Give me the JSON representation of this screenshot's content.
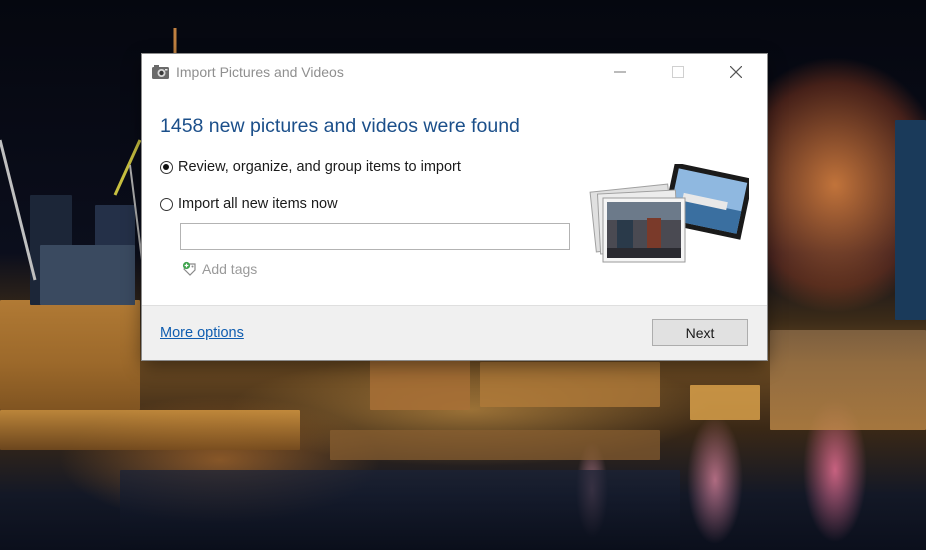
{
  "window": {
    "title": "Import Pictures and Videos",
    "heading": "1458 new pictures and videos were found"
  },
  "options": {
    "review": {
      "label": "Review, organize, and group items to import",
      "checked": true
    },
    "import_all": {
      "label": "Import all new items now",
      "checked": false
    }
  },
  "tags": {
    "input_value": "",
    "add_tags_label": "Add tags"
  },
  "footer": {
    "more_options_label": "More options",
    "next_label": "Next"
  },
  "colors": {
    "heading": "#1b4f8a",
    "link": "#0f5db0",
    "footer_background": "#f0f0f0"
  },
  "icons": {
    "app": "camera-icon",
    "add_tags": "tag-plus-icon",
    "illustration": "photo-stack-icon"
  }
}
